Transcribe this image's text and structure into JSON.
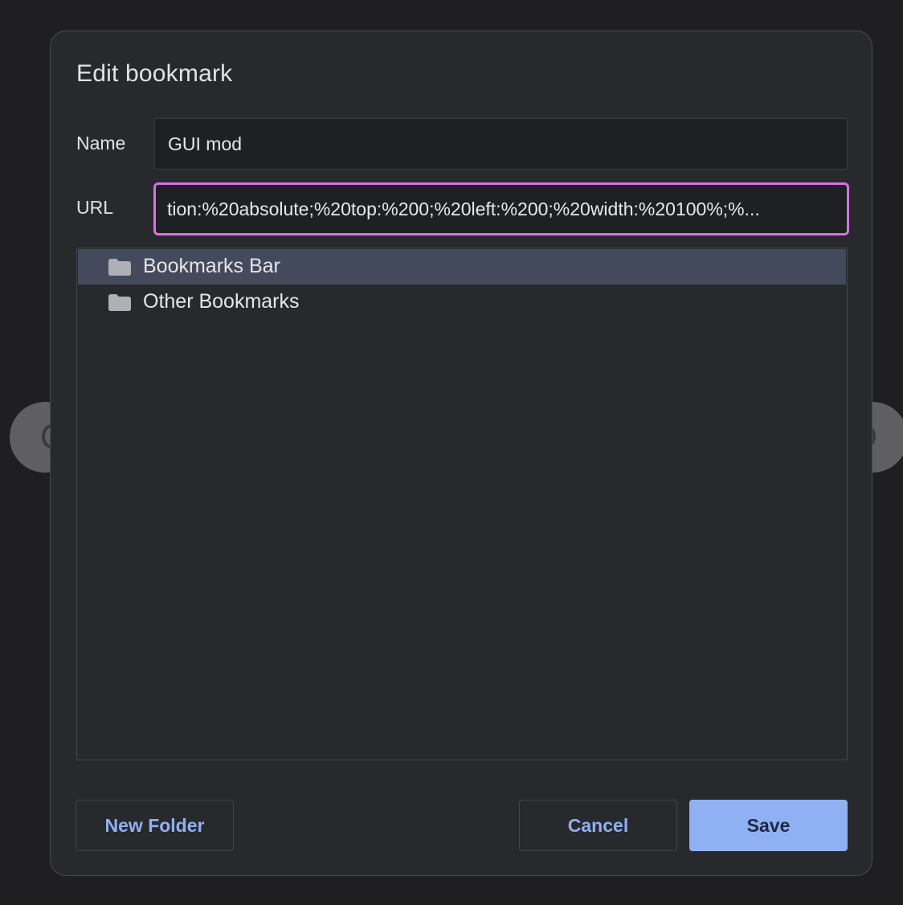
{
  "dialog": {
    "title": "Edit bookmark"
  },
  "fields": {
    "name_label": "Name",
    "name_value": "GUI mod",
    "url_label": "URL",
    "url_visible_value": "tion:%20absolute;%20top:%200;%20left:%200;%20width:%20100%;%..."
  },
  "folders": [
    {
      "label": "Bookmarks Bar",
      "icon": "folder-icon",
      "selected": true
    },
    {
      "label": "Other Bookmarks",
      "icon": "folder-icon",
      "selected": false
    }
  ],
  "buttons": {
    "new_folder": "New Folder",
    "cancel": "Cancel",
    "save": "Save"
  },
  "colors": {
    "accent": "#8fb0f2",
    "focus_ring": "#d770e4",
    "selected_row": "#434a5b",
    "dialog_bg": "#28292d"
  }
}
